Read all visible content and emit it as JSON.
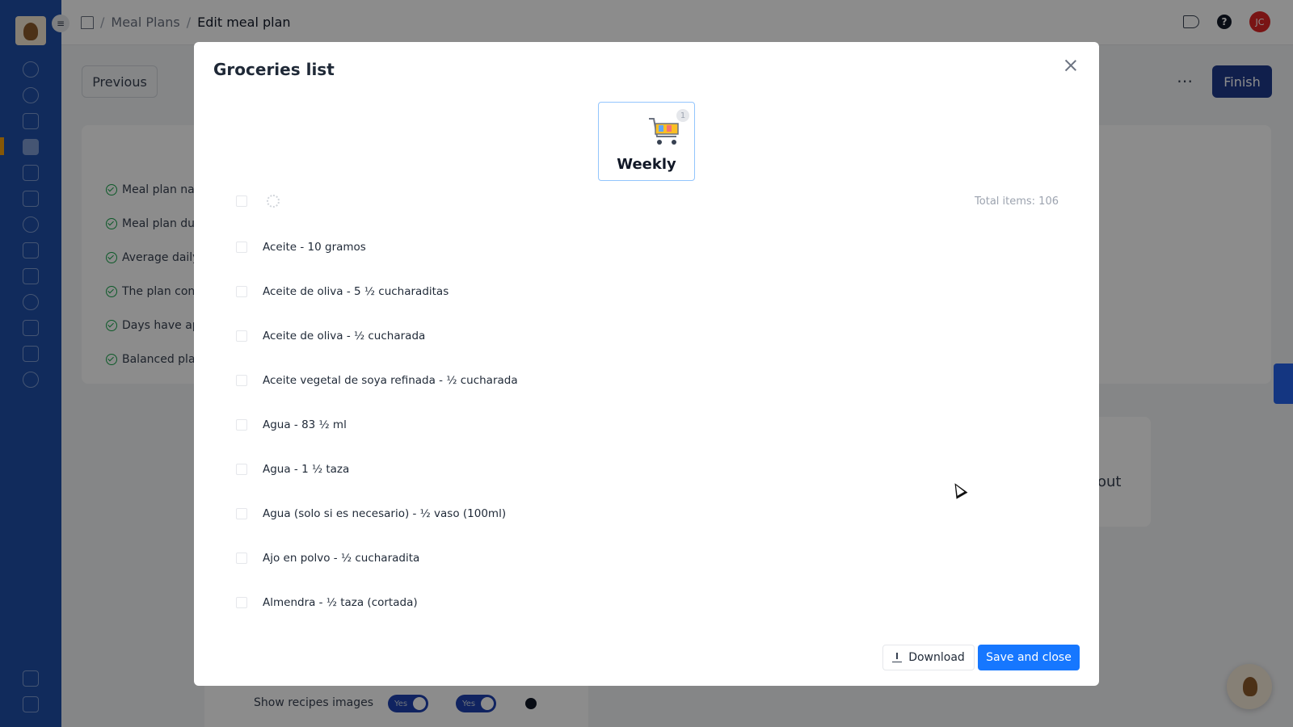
{
  "topbar": {
    "breadcrumb": [
      "Meal Plans",
      "Edit meal plan"
    ],
    "avatar_initials": "JC"
  },
  "page": {
    "previous_label": "Previous",
    "finish_label": "Finish",
    "more_label": "⋯",
    "checklist": [
      "Meal plan nar",
      "Meal plan dur",
      "Average daily",
      "The plan consi",
      "Days have app",
      "Balanced plan"
    ],
    "side_card_text": "out",
    "show_images_label": "Show recipes images",
    "toggle_yes": "Yes"
  },
  "modal": {
    "title": "Groceries list",
    "tab_label": "Weekly",
    "tab_badge": "1",
    "total_items": "Total items: 106",
    "items": [
      "Aceite - 10 gramos",
      "Aceite de oliva - 5 ½ cucharaditas",
      "Aceite de oliva - ½ cucharada",
      "Aceite vegetal de soya refinada - ½ cucharada",
      "Agua - 83 ½ ml",
      "Agua - 1 ½ taza",
      "Agua (solo si es necesario) - ½ vaso (100ml)",
      "Ajo en polvo - ½ cucharadita",
      "Almendra - ½ taza (cortada)"
    ],
    "download_label": "Download",
    "save_label": "Save and close"
  }
}
